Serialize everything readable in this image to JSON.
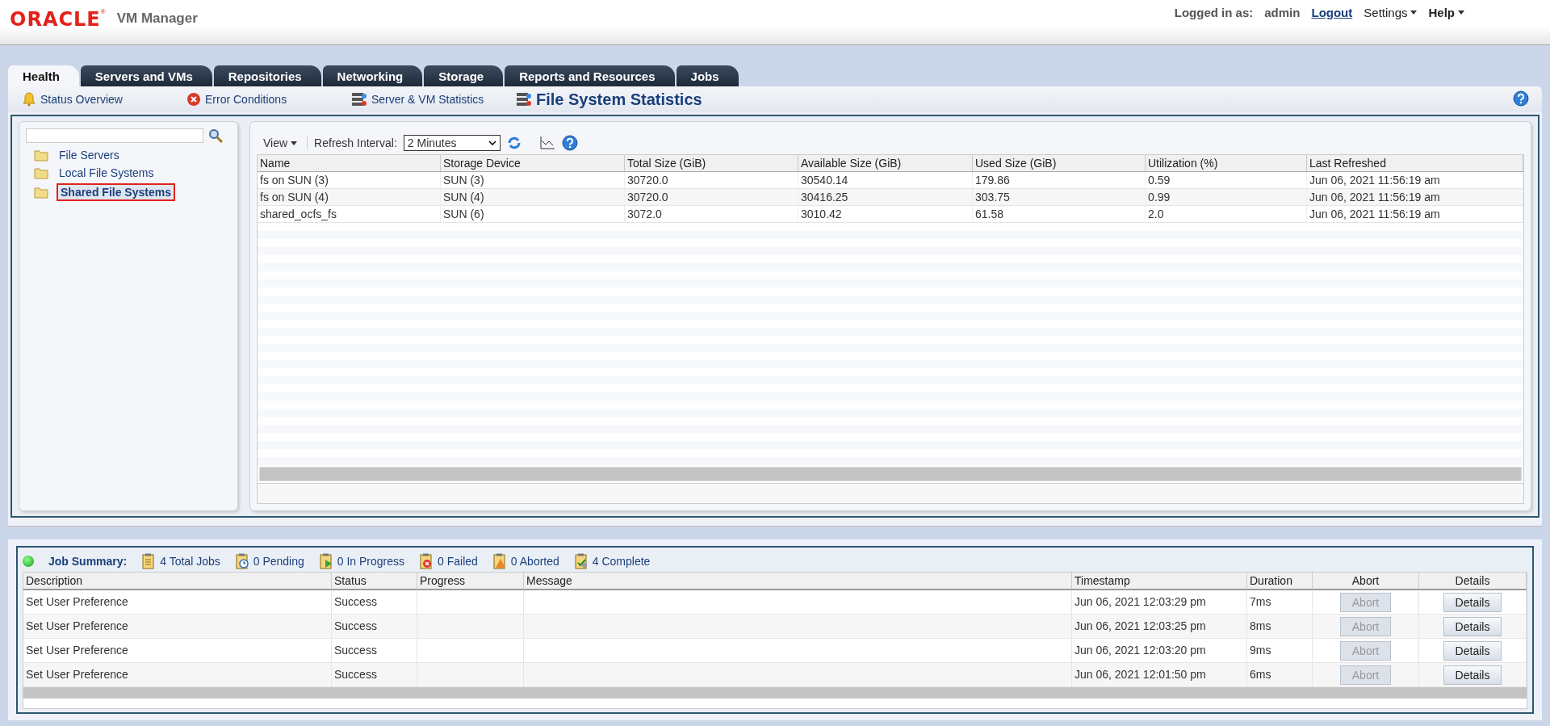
{
  "header": {
    "logo": "ORACLE",
    "logo_mark": "®",
    "product": "VM Manager",
    "logged_in_label": "Logged in as:",
    "user": "admin",
    "logout": "Logout",
    "settings": "Settings",
    "help": "Help"
  },
  "tabs": [
    {
      "label": "Health",
      "selected": true
    },
    {
      "label": "Servers and VMs",
      "selected": false
    },
    {
      "label": "Repositories",
      "selected": false
    },
    {
      "label": "Networking",
      "selected": false
    },
    {
      "label": "Storage",
      "selected": false
    },
    {
      "label": "Reports and Resources",
      "selected": false
    },
    {
      "label": "Jobs",
      "selected": false
    }
  ],
  "subtabs": [
    {
      "label": "Status Overview",
      "kind": "bell",
      "selected": false
    },
    {
      "label": "Error Conditions",
      "kind": "error",
      "selected": false
    },
    {
      "label": "Server & VM Statistics",
      "kind": "server",
      "selected": false
    },
    {
      "label": "File System Statistics",
      "kind": "server",
      "selected": true
    }
  ],
  "tree": {
    "items": [
      {
        "label": "File Servers",
        "selected": false
      },
      {
        "label": "Local File Systems",
        "selected": false
      },
      {
        "label": "Shared File Systems",
        "selected": true
      }
    ]
  },
  "toolbar": {
    "view": "View",
    "refresh_label": "Refresh Interval:",
    "refresh_value": "2 Minutes"
  },
  "table": {
    "columns": [
      "Name",
      "Storage Device",
      "Total Size (GiB)",
      "Available Size (GiB)",
      "Used Size (GiB)",
      "Utilization (%)",
      "Last Refreshed"
    ],
    "rows": [
      [
        "fs on SUN (3)",
        "SUN (3)",
        "30720.0",
        "30540.14",
        "179.86",
        "0.59",
        "Jun 06, 2021 11:56:19 am"
      ],
      [
        "fs on SUN (4)",
        "SUN (4)",
        "30720.0",
        "30416.25",
        "303.75",
        "0.99",
        "Jun 06, 2021 11:56:19 am"
      ],
      [
        "shared_ocfs_fs",
        "SUN (6)",
        "3072.0",
        "3010.42",
        "61.58",
        "2.0",
        "Jun 06, 2021 11:56:19 am"
      ]
    ]
  },
  "job_summary": {
    "title": "Job Summary:",
    "counts": [
      {
        "kind": "total",
        "label": "4 Total Jobs"
      },
      {
        "kind": "pending",
        "label": "0 Pending"
      },
      {
        "kind": "progress",
        "label": "0 In Progress"
      },
      {
        "kind": "failed",
        "label": "0 Failed"
      },
      {
        "kind": "aborted",
        "label": "0 Aborted"
      },
      {
        "kind": "complete",
        "label": "4 Complete"
      }
    ],
    "columns": [
      "Description",
      "Status",
      "Progress",
      "Message",
      "Timestamp",
      "Duration",
      "Abort",
      "Details"
    ],
    "rows": [
      {
        "description": "Set User Preference",
        "status": "Success",
        "timestamp": "Jun 06, 2021 12:03:29 pm",
        "duration": "7ms",
        "abort": "Abort",
        "abort_disabled": true,
        "details": "Details"
      },
      {
        "description": "Set User Preference",
        "status": "Success",
        "timestamp": "Jun 06, 2021 12:03:25 pm",
        "duration": "8ms",
        "abort": "Abort",
        "abort_disabled": true,
        "details": "Details"
      },
      {
        "description": "Set User Preference",
        "status": "Success",
        "timestamp": "Jun 06, 2021 12:03:20 pm",
        "duration": "9ms",
        "abort": "Abort",
        "abort_disabled": true,
        "details": "Details"
      },
      {
        "description": "Set User Preference",
        "status": "Success",
        "timestamp": "Jun 06, 2021 12:01:50 pm",
        "duration": "6ms",
        "abort": "Abort",
        "abort_disabled": true,
        "details": "Details"
      }
    ]
  }
}
